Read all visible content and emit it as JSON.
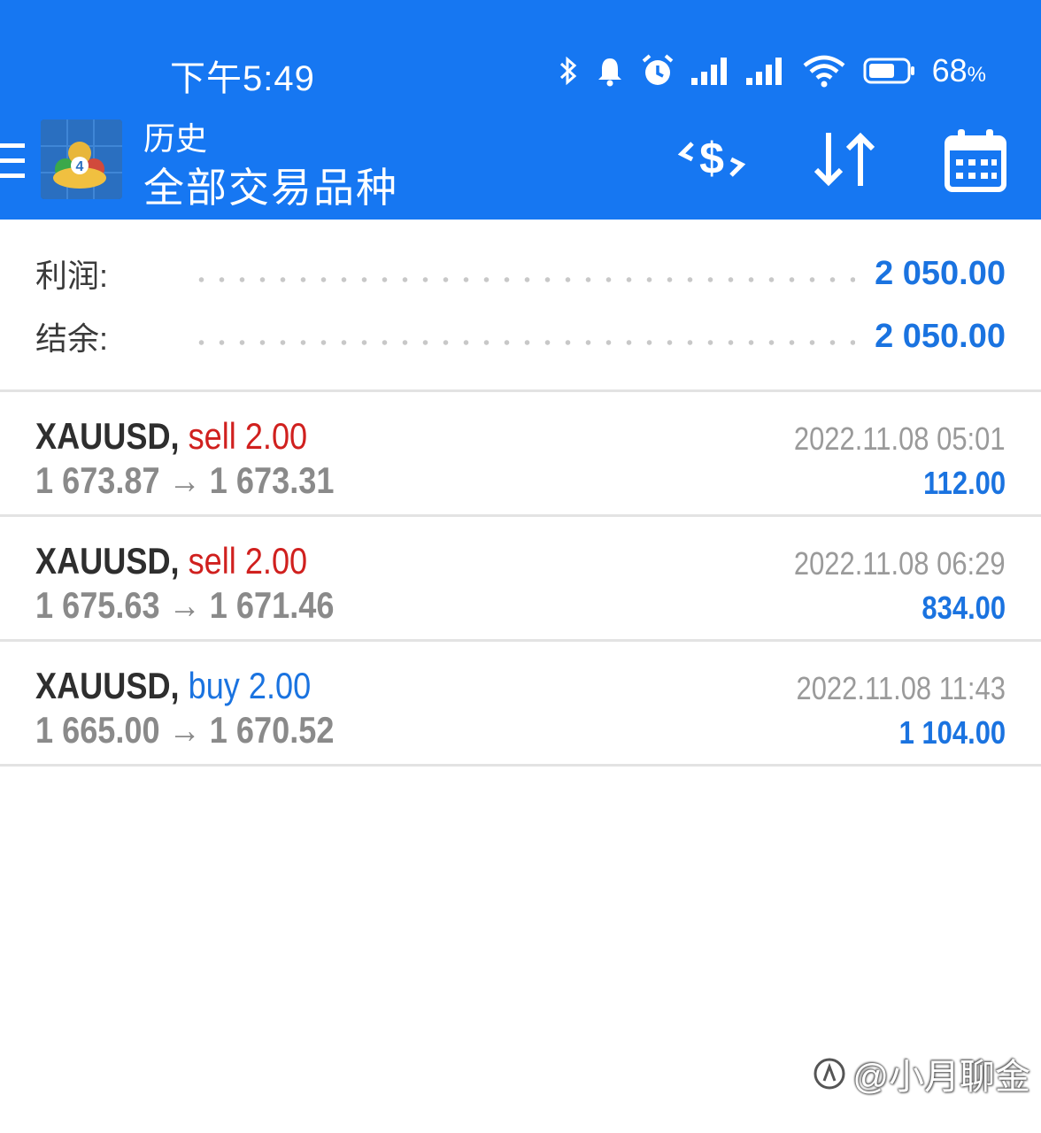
{
  "status_bar": {
    "time": "下午5:49",
    "battery_percent": "68",
    "battery_unit": "%",
    "icons": [
      "bluetooth-icon",
      "notification-bell-icon",
      "alarm-icon",
      "signal-1-icon",
      "signal-2-icon",
      "wifi-icon",
      "battery-icon"
    ]
  },
  "toolbar": {
    "title": "历史",
    "subtitle": "全部交易品种",
    "icons": [
      "menu-icon",
      "app-logo",
      "currency-exchange-icon",
      "sort-icon",
      "calendar-icon"
    ]
  },
  "summary": {
    "profit_label": "利润:",
    "profit_value": "2 050.00",
    "balance_label": "结余:",
    "balance_value": "2 050.00"
  },
  "trades": [
    {
      "symbol": "XAUUSD,",
      "type": "sell 2.00",
      "open": "1 673.87",
      "arrow": "→",
      "close": "1 673.31",
      "time": "2022.11.08 05:01",
      "profit": "112.00"
    },
    {
      "symbol": "XAUUSD,",
      "type": "sell 2.00",
      "open": "1 675.63",
      "arrow": "→",
      "close": "1 671.46",
      "time": "2022.11.08 06:29",
      "profit": "834.00"
    },
    {
      "symbol": "XAUUSD,",
      "type": "buy 2.00",
      "open": "1 665.00",
      "arrow": "→",
      "close": "1 670.52",
      "time": "2022.11.08 11:43",
      "profit": "1 104.00"
    }
  ],
  "watermark": "@小月聊金",
  "colors": {
    "primary": "#1677f2",
    "sell": "#d0201e",
    "buy": "#1a73e0",
    "profit": "#1a73e0"
  }
}
